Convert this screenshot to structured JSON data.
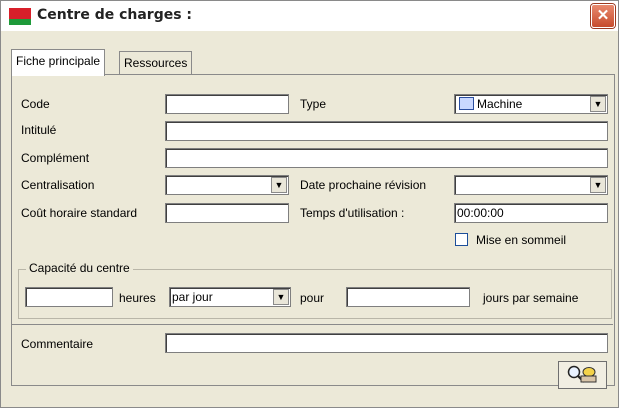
{
  "window": {
    "title": "Centre de charges :",
    "close_label": "✕"
  },
  "tabs": [
    {
      "label": "Fiche principale",
      "active": true
    },
    {
      "label": "Ressources",
      "active": false
    }
  ],
  "form": {
    "code_label": "Code",
    "code_value": "",
    "type_label": "Type",
    "type_value": "Machine",
    "intitule_label": "Intitulé",
    "intitule_value": "",
    "complement_label": "Complément",
    "complement_value": "",
    "centralisation_label": "Centralisation",
    "centralisation_value": "",
    "date_label": "Date prochaine révision",
    "date_value": "",
    "cout_label": "Coût horaire standard",
    "cout_value": "",
    "temps_label": "Temps d'utilisation :",
    "temps_value": "00:00:00",
    "sommeil_label": "Mise en sommeil",
    "sommeil_checked": false
  },
  "capacite": {
    "title": "Capacité du centre",
    "hours_value": "",
    "heures_label": "heures",
    "per_value": "par jour",
    "pour_label": "pour",
    "days_value": "",
    "jours_label": "jours par semaine"
  },
  "commentaire": {
    "label": "Commentaire",
    "value": ""
  },
  "icons": {
    "app": "app-flag-icon",
    "type": "machine-icon",
    "action": "search-key-icon"
  },
  "colors": {
    "window_bg": "#ece9d8",
    "close_bg": "#d15a3a",
    "border": "#8a8a8a"
  }
}
